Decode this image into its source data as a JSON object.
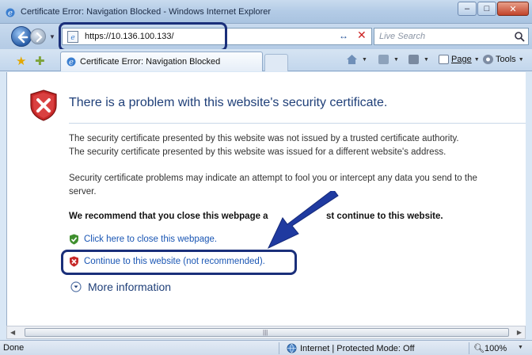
{
  "window": {
    "title": "Certificate Error: Navigation Blocked - Windows Internet Explorer",
    "min_label": "–",
    "max_label": "□",
    "close_label": "✕"
  },
  "nav": {
    "url": "https://10.136.100.133/",
    "search_placeholder": "Live Search",
    "refresh_glyph": "↔",
    "stop_glyph": "✕"
  },
  "tabs": [
    {
      "label": "Certificate Error: Navigation Blocked"
    }
  ],
  "commands": {
    "page_label": "Page",
    "tools_label": "Tools"
  },
  "content": {
    "heading": "There is a problem with this website's security certificate.",
    "para1_line1": "The security certificate presented by this website was not issued by a trusted certificate authority.",
    "para1_line2": "The security certificate presented by this website was issued for a different website's address.",
    "para2_line1": "Security certificate problems may indicate an attempt to fool you or intercept any data you send to the",
    "para2_line2": "server.",
    "recommend_left": "We recommend that you close this webpage a",
    "recommend_right": "st continue to this website.",
    "close_link": "Click here to close this webpage.",
    "continue_link": "Continue to this website (not recommended).",
    "more_info": "More information"
  },
  "status": {
    "text": "Done",
    "zone": "Internet | Protected Mode: Off",
    "zoom": "100%"
  },
  "colors": {
    "heading": "#1f3f78",
    "link": "#1a56b4",
    "annotation": "#1a2f7a"
  }
}
